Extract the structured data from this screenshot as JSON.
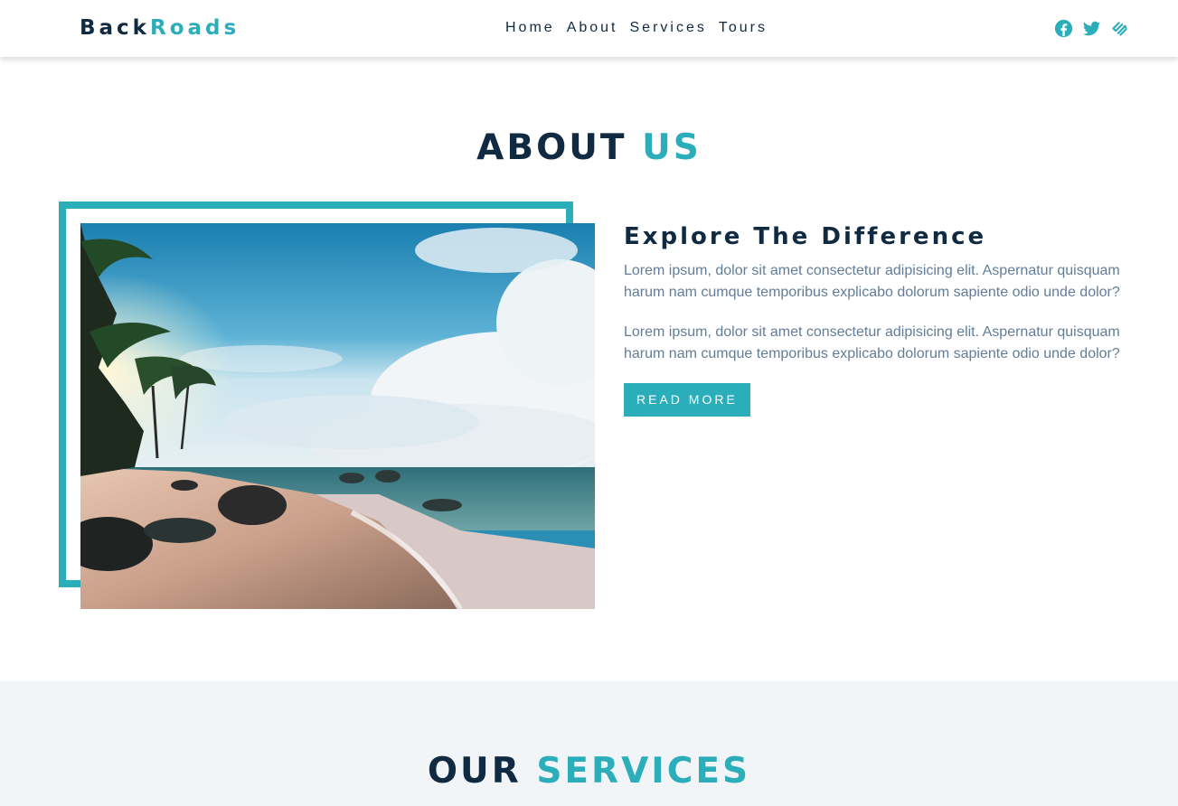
{
  "brand": {
    "part1": "Back",
    "part2": "Roads"
  },
  "nav": {
    "links": [
      "Home",
      "About",
      "Services",
      "Tours"
    ]
  },
  "social": {
    "icons": [
      "facebook-icon",
      "twitter-icon",
      "squarespace-icon"
    ]
  },
  "about": {
    "title_1": "ABOUT",
    "title_2": "US",
    "heading": "Explore The Difference",
    "paragraphs": [
      "Lorem ipsum, dolor sit amet consectetur adipisicing elit. Aspernatur quisquam harum nam cumque temporibus explicabo dolorum sapiente odio unde dolor?",
      "Lorem ipsum, dolor sit amet consectetur adipisicing elit. Aspernatur quisquam harum nam cumque temporibus explicabo dolorum sapiente odio unde dolor?"
    ],
    "button": "READ MORE"
  },
  "services": {
    "title_1": "OUR",
    "title_2": "SERVICES"
  },
  "colors": {
    "primary": "#2caeba",
    "dark": "#102a42",
    "text": "#617d98",
    "section_bg": "#f1f5f8"
  }
}
